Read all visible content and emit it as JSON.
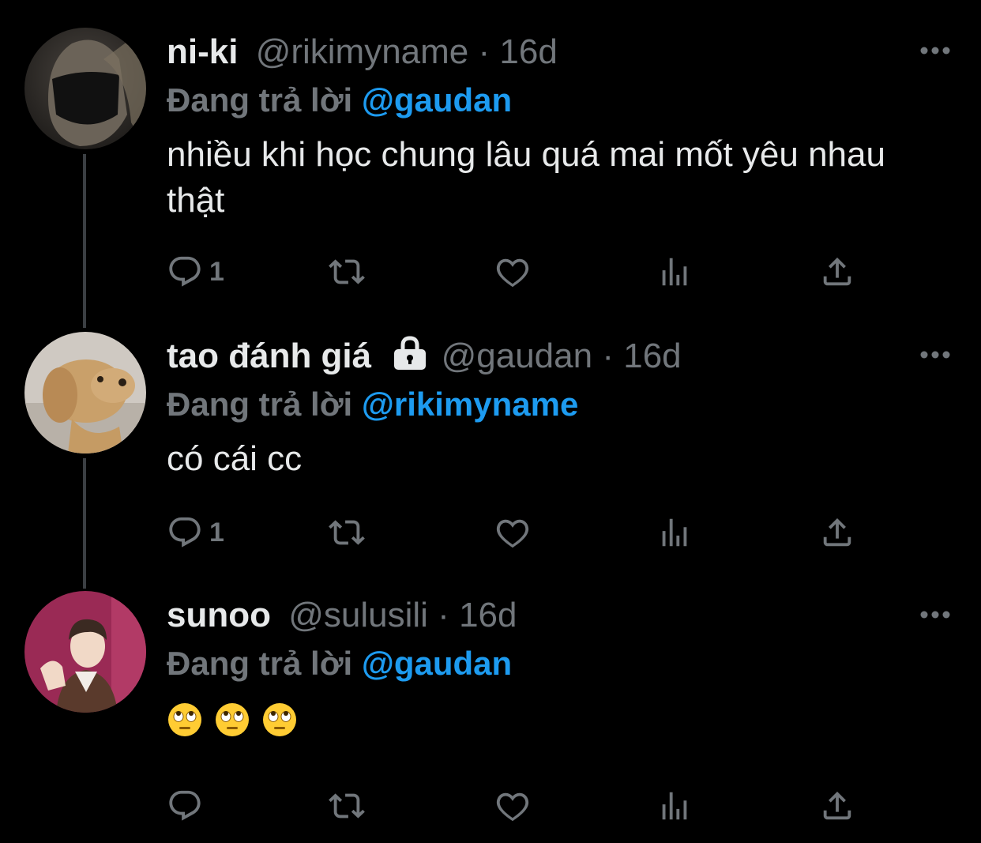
{
  "tweets": [
    {
      "name": "ni-ki",
      "handle": "@rikimyname",
      "separator": "·",
      "time": "16d",
      "reply_prefix": "Đang trả lời",
      "reply_to": "@gaudan",
      "text": "nhiều khi học chung lâu quá mai mốt yêu nhau thật",
      "reply_count": "1",
      "locked": false
    },
    {
      "name": "tao đánh giá",
      "handle": "@gaudan",
      "separator": "·",
      "time": "16d",
      "reply_prefix": "Đang trả lời",
      "reply_to": "@rikimyname",
      "text": "có cái cc",
      "reply_count": "1",
      "locked": true
    },
    {
      "name": "sunoo",
      "handle": "@sulusili",
      "separator": "·",
      "time": "16d",
      "reply_prefix": "Đang trả lời",
      "reply_to": "@gaudan",
      "emojis": [
        "face-with-rolling-eyes",
        "face-with-rolling-eyes",
        "face-with-rolling-eyes"
      ],
      "reply_count": "",
      "locked": false
    }
  ],
  "icons": {
    "reply": "reply-icon",
    "retweet": "retweet-icon",
    "like": "heart-icon",
    "views": "views-icon",
    "share": "share-icon",
    "more": "more-icon",
    "lock": "lock-icon"
  },
  "colors": {
    "background": "#000000",
    "text": "#e7e9ea",
    "secondary": "#71767b",
    "mention": "#1d9bf0",
    "thread_line": "#3b3f43"
  }
}
